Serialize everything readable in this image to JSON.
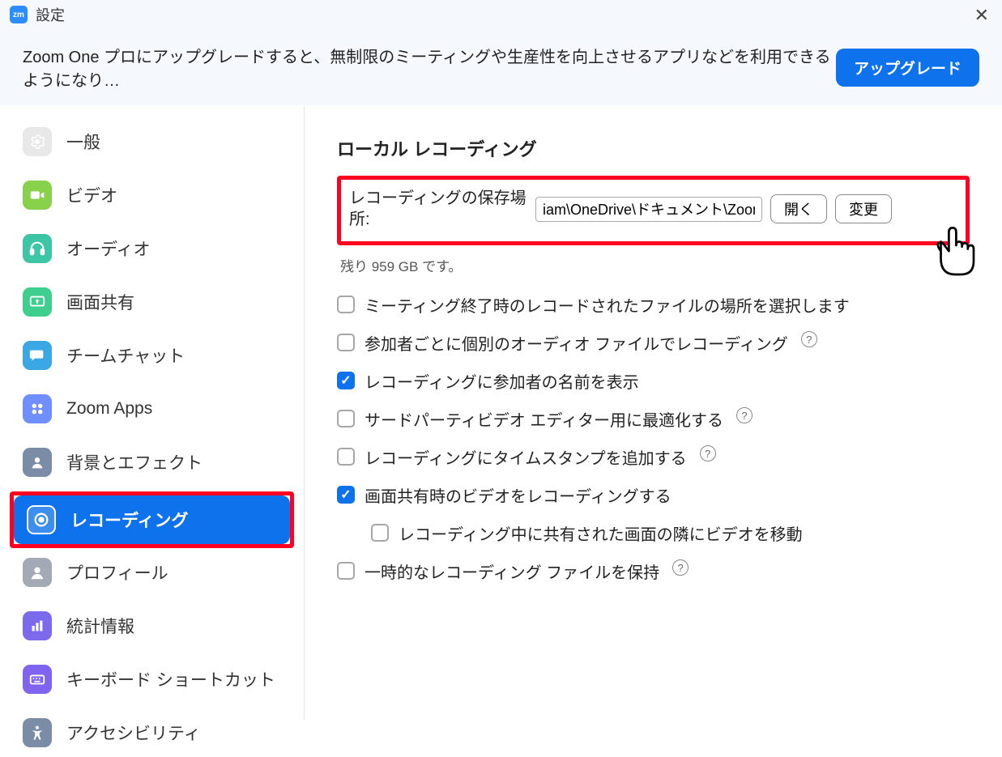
{
  "titlebar": {
    "app_short": "zm",
    "title": "設定"
  },
  "banner": {
    "text": "Zoom One プロにアップグレードすると、無制限のミーティングや生産性を向上させるアプリなどを利用できるようになり…",
    "button": "アップグレード"
  },
  "sidebar": {
    "items": [
      {
        "label": "一般"
      },
      {
        "label": "ビデオ"
      },
      {
        "label": "オーディオ"
      },
      {
        "label": "画面共有"
      },
      {
        "label": "チームチャット"
      },
      {
        "label": "Zoom Apps"
      },
      {
        "label": "背景とエフェクト"
      },
      {
        "label": "レコーディング"
      },
      {
        "label": "プロフィール"
      },
      {
        "label": "統計情報"
      },
      {
        "label": "キーボード ショートカット"
      },
      {
        "label": "アクセシビリティ"
      }
    ]
  },
  "recording": {
    "section_title": "ローカル レコーディング",
    "location_label": "レコーディングの保存場所:",
    "location_value": "iam\\OneDrive\\ドキュメント\\Zoom",
    "open_btn": "開く",
    "change_btn": "変更",
    "remaining": "残り 959 GB です。",
    "options": [
      {
        "label": "ミーティング終了時のレコードされたファイルの場所を選択します",
        "checked": false,
        "help": false
      },
      {
        "label": "参加者ごとに個別のオーディオ ファイルでレコーディング",
        "checked": false,
        "help": true
      },
      {
        "label": "レコーディングに参加者の名前を表示",
        "checked": true,
        "help": false
      },
      {
        "label": "サードパーティビデオ エディター用に最適化する",
        "checked": false,
        "help": true
      },
      {
        "label": "レコーディングにタイムスタンプを追加する",
        "checked": false,
        "help": true
      },
      {
        "label": "画面共有時のビデオをレコーディングする",
        "checked": true,
        "help": false
      },
      {
        "label": "レコーディング中に共有された画面の隣にビデオを移動",
        "checked": false,
        "help": false,
        "sub": true
      },
      {
        "label": "一時的なレコーディング ファイルを保持",
        "checked": false,
        "help": true
      }
    ]
  }
}
